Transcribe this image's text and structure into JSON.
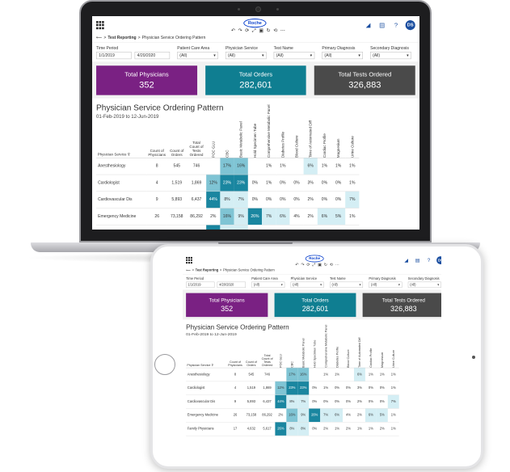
{
  "app": {
    "brand": "Roche",
    "avatar": "DS",
    "breadcrumb": [
      "Test Reporting",
      "Physician Service Ordering Pattern"
    ]
  },
  "filters": [
    {
      "label": "Time Period",
      "from": "1/1/2019",
      "to": "4/20/2020"
    },
    {
      "label": "Patient Care Area",
      "value": "(All)"
    },
    {
      "label": "Physician Service",
      "value": "(All)"
    },
    {
      "label": "Test Name",
      "value": "(All)"
    },
    {
      "label": "Primary Diagnosis",
      "value": "(All)"
    },
    {
      "label": "Secondary Diagnosis",
      "value": "(All)"
    }
  ],
  "kpis": [
    {
      "label": "Total Physicians",
      "value": "352",
      "color": "#7a2183"
    },
    {
      "label": "Total Orders",
      "value": "282,601",
      "color": "#0f7e91"
    },
    {
      "label": "Total Tests Ordered",
      "value": "326,883",
      "color": "#4a4a4a"
    }
  ],
  "report": {
    "title": "Physician Service Ordering Pattern",
    "subtitle": "01-Feb-2019 to 12-Jun-2019",
    "columns": {
      "service": "Physician Service",
      "physicians": "Count of Physicians",
      "orders": "Count of Orders",
      "tests": "Total Count of Tests Ordered"
    },
    "test_columns": [
      "POC GLU",
      "CBC",
      "Basic Metabolic Panel",
      "Hold Specimen Tube",
      "Comprehensive Metabolic Panel",
      "Diabetes Profile",
      "Blood Culture",
      "Time of Automated Diff",
      "Cardiac Profile",
      "Magnesium",
      "Urine Culture"
    ],
    "rows": [
      {
        "service": "Anesthesiology",
        "physicians": "8",
        "orders": "545",
        "tests": "746",
        "pct": [
          "",
          "17%",
          "16%",
          "",
          "1%",
          "1%",
          "",
          "6%",
          "1%",
          "1%",
          "1%"
        ]
      },
      {
        "service": "Cardiologist",
        "physicians": "4",
        "orders": "1,519",
        "tests": "1,869",
        "pct": [
          "12%",
          "23%",
          "23%",
          "0%",
          "1%",
          "0%",
          "0%",
          "3%",
          "0%",
          "0%",
          "1%"
        ]
      },
      {
        "service": "Cardiovascular Dis",
        "physicians": "9",
        "orders": "5,893",
        "tests": "6,437",
        "pct": [
          "44%",
          "8%",
          "7%",
          "0%",
          "0%",
          "0%",
          "0%",
          "2%",
          "0%",
          "0%",
          "7%"
        ]
      },
      {
        "service": "Emergency Medicine",
        "physicians": "26",
        "orders": "73,158",
        "tests": "86,292",
        "pct": [
          "2%",
          "16%",
          "9%",
          "26%",
          "7%",
          "6%",
          "4%",
          "2%",
          "6%",
          "5%",
          "1%"
        ]
      },
      {
        "service": "Family Physicians",
        "physicians": "17",
        "orders": "4,632",
        "tests": "5,617",
        "pct": [
          "26%",
          "8%",
          "8%",
          "0%",
          "2%",
          "1%",
          "2%",
          "1%",
          "1%",
          "2%",
          "1%"
        ]
      }
    ]
  },
  "colors": {
    "heat_high": "#1a86a0",
    "heat_mid": "#7fc4d4",
    "heat_low": "#d4eef4",
    "accent": "#1a4ea0"
  }
}
